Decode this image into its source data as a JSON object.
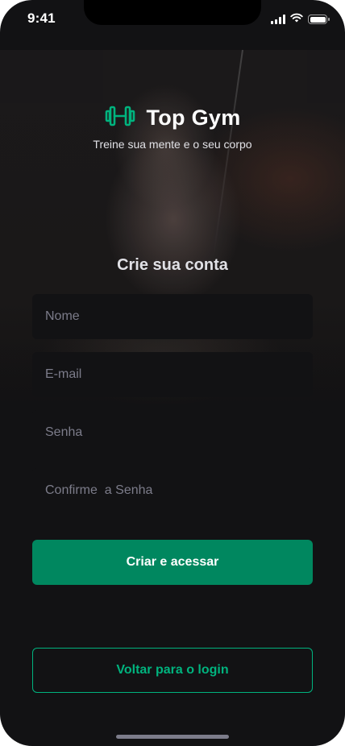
{
  "status_bar": {
    "time": "9:41",
    "icons": [
      "signal-icon",
      "wifi-icon",
      "battery-icon"
    ]
  },
  "brand": {
    "title": "Top Gym",
    "tagline": "Treine sua mente e o seu corpo",
    "logo_icon": "dumbbell-icon",
    "logo_color": "#00b37e"
  },
  "form": {
    "heading": "Crie sua conta",
    "name_placeholder": "Nome",
    "email_placeholder": "E-mail",
    "password_placeholder": "Senha",
    "confirm_placeholder": "Confirme  a Senha",
    "submit_label": "Criar e acessar"
  },
  "footer": {
    "back_label": "Voltar para o login"
  },
  "colors": {
    "background": "#121214",
    "input_background": "#121214",
    "primary": "#00875f",
    "accent": "#00b37e",
    "text": "#e1e1e6",
    "placeholder": "#7c7c8a"
  }
}
